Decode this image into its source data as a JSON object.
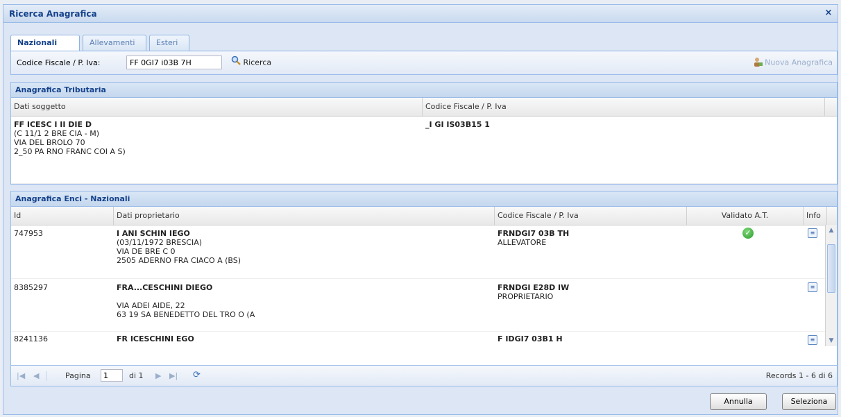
{
  "window": {
    "title": "Ricerca Anagrafica",
    "close_glyph": "×"
  },
  "tabs": [
    {
      "label": "Nazionali",
      "active": true
    },
    {
      "label": "Allevamenti",
      "active": false
    },
    {
      "label": "Esteri",
      "active": false
    }
  ],
  "toolbar": {
    "search_label": "Codice Fiscale / P. Iva:",
    "search_value": "FF 0GI7 i03B 7H",
    "search_button": "Ricerca",
    "search_icon": "magnifier-icon",
    "new_button": "Nuova Anagrafica",
    "new_icon": "user-add-icon"
  },
  "tributaria": {
    "title": "Anagrafica Tributaria",
    "columns": [
      "Dati soggetto",
      "Codice Fiscale / P. Iva"
    ],
    "row": {
      "line1": "FF ICESC I II DIE D",
      "line2": "(C 11/1 2 BRE CIA - M)",
      "line3": "VIA DEL BROLO 70",
      "line4": "2_50 PA RNO FRANC COI A S)",
      "cf": "_I GI IS03B15 1"
    }
  },
  "enci": {
    "title": "Anagrafica Enci - Nazionali",
    "columns": [
      "Id",
      "Dati proprietario",
      "Codice Fiscale / P. Iva",
      "Validato A.T.",
      "Info"
    ],
    "rows": [
      {
        "id": "747953",
        "name": "I ANI SCHIN IEGO",
        "line2": "(03/11/1972 BRESCIA)",
        "line3": "VIA DE BRE C 0",
        "line4": "2505 ADERNO FRA CIACO A (BS)",
        "cf": "FRNDGI7 03B TH",
        "role": "ALLEVATORE",
        "validated": true
      },
      {
        "id": "8385297",
        "name": "FRA...CESCHINI DIEGO",
        "line2": "",
        "line3": "VIA ADEI AIDE, 22",
        "line4": "63 19 SA BENEDETTO DEL TRO O (A",
        "cf": "FRNDGI E28D IW",
        "role": "PROPRIETARIO",
        "validated": false
      },
      {
        "id": "8241136",
        "name": "FR ICESCHINI EGO",
        "line2": "",
        "line3": "",
        "line4": "",
        "cf": "F IDGI7 03B1 H",
        "role": "",
        "validated": false
      }
    ]
  },
  "pager": {
    "page_label": "Pagina",
    "page_value": "1",
    "of_label": "di 1",
    "records": "Records 1 - 6 di 6"
  },
  "footer": {
    "cancel": "Annulla",
    "select": "Seleziona"
  },
  "colors": {
    "accent": "#15428b",
    "border": "#99bbe8",
    "header_bg": "#c5d7ee",
    "check_green": "#2a9a2a"
  }
}
